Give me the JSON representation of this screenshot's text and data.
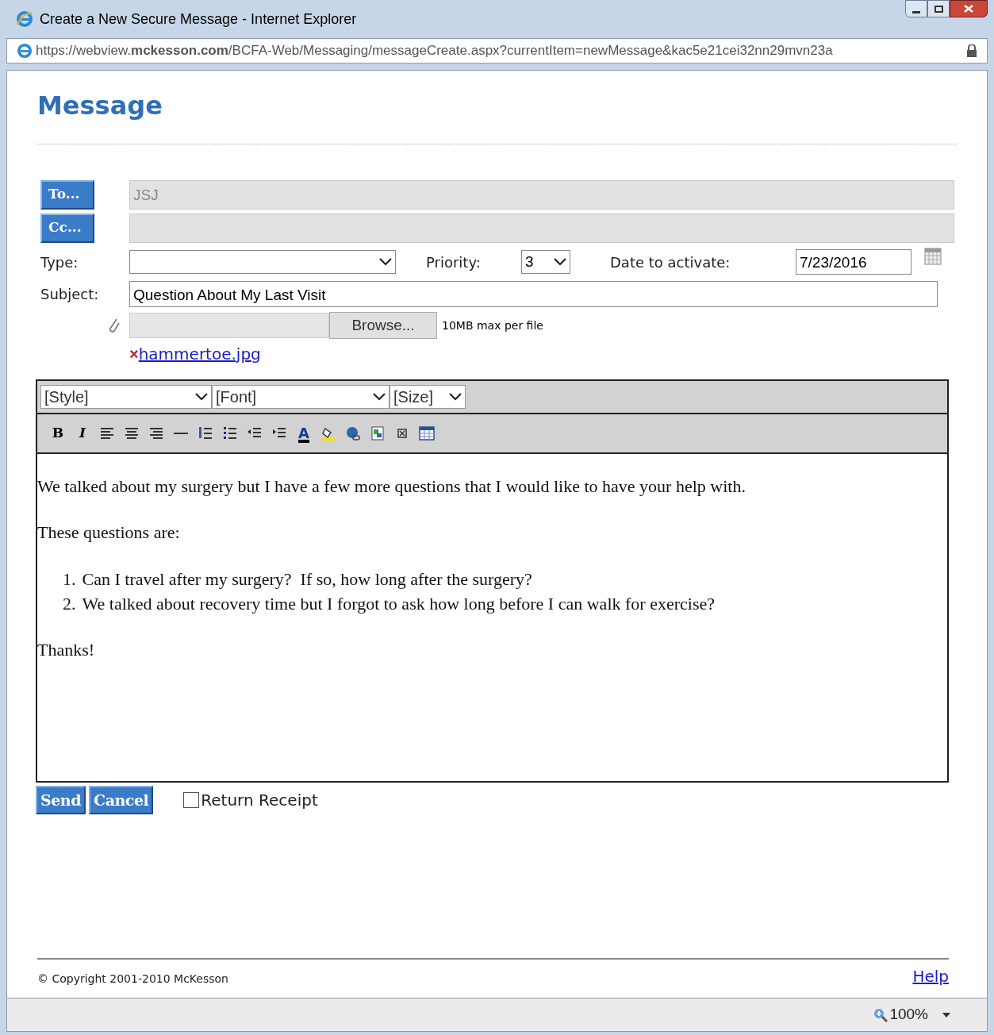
{
  "window": {
    "title": "Create a New Secure Message - Internet Explorer"
  },
  "address_bar": {
    "url": "https://webview.**mckesson.com**/BCFA-Web/Messaging/messageCreate.aspx?currentItem=newMessage&kac5e21cei32nn29mvn23a"
  },
  "heading": "Message",
  "to": {
    "button": "To...",
    "value": "JSJ"
  },
  "cc": {
    "button": "Cc..."
  },
  "type": {
    "label": "Type:"
  },
  "priority": {
    "label": "Priority:",
    "value": "3"
  },
  "date": {
    "label": "Date to activate:",
    "value": "7/23/2016"
  },
  "subject": {
    "label": "Subject:",
    "value": "Question About My Last Visit"
  },
  "attachment": {
    "browse": "Browse...",
    "note": "10MB max per file",
    "remove": "×",
    "file": "hammertoe.jpg"
  },
  "editor": {
    "selects": [
      "[Style]",
      "[Font]",
      "[Size]"
    ],
    "tools": [
      {
        "kind": "bold",
        "label": "B"
      },
      {
        "kind": "italic",
        "label": "I"
      },
      {
        "kind": "align-left"
      },
      {
        "kind": "align-center"
      },
      {
        "kind": "align-right"
      },
      {
        "kind": "rule"
      },
      {
        "kind": "numbered"
      },
      {
        "kind": "bulleted"
      },
      {
        "kind": "outdent"
      },
      {
        "kind": "indent"
      },
      {
        "kind": "text-color",
        "label": "A"
      },
      {
        "kind": "highlight"
      },
      {
        "kind": "link"
      },
      {
        "kind": "image"
      },
      {
        "kind": "embed"
      },
      {
        "kind": "table"
      }
    ],
    "paragraphs_before": [
      "We talked about my surgery but I have a few more questions that I would like to have your help with.",
      "These questions are:"
    ],
    "list": [
      {
        "number": "1.",
        "text": "Can I travel after my surgery?  If so, how long after the surgery?"
      },
      {
        "number": "2.",
        "text": "We talked about recovery time but I forgot to ask how long before I can walk for exercise?"
      }
    ],
    "paragraphs_after": [
      "Thanks!"
    ]
  },
  "buttons": [
    "Send",
    "Cancel"
  ],
  "return_receipt": {
    "label": "Return Receipt",
    "checked": false
  },
  "footer": {
    "copyright": "© Copyright 2001-2010 McKesson",
    "help": "Help"
  },
  "status_bar": {
    "zoom": "100%"
  }
}
